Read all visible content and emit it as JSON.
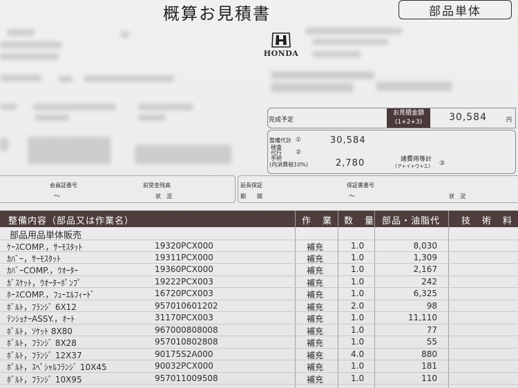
{
  "header": {
    "title": "概算お見積書",
    "badge": "部品単体",
    "brand": "HONDA"
  },
  "summary": {
    "completion_label": "完成予定",
    "estimate_label_1": "お見積金額",
    "estimate_label_2": "(1+2+3)",
    "estimate_total": "30,584",
    "yen": "円",
    "service_label": "整備代計",
    "service_mark": "①",
    "service_value": "30,584",
    "sub_labels": [
      "検査",
      "代行",
      "手続"
    ],
    "sub_mark": "②",
    "tax_label": "(内消費税10%)",
    "tax_value": "2,780",
    "fees_label": "諸費用等計",
    "fees_formula": "(ア+イ+ウ+エ)",
    "fees_mark": "③"
  },
  "info": {
    "member_no": "会員証番号",
    "prepaid": "前受金残高",
    "status": "状　況",
    "tilde": "〜",
    "ext_warranty": "延長保証",
    "period": "期　　間",
    "cert_no": "保証書番号",
    "status2": "状　況"
  },
  "table": {
    "headers": [
      "整備内容（部品又は作業名）",
      "作　業",
      "数　量",
      "部品・油脂代",
      "技　術　料"
    ],
    "category": "部品用品単体販売",
    "rows": [
      {
        "name": "ｹｰｽCOMP.，ｻｰﾓｽﾀｯﾄ",
        "part": "19320PCX000",
        "work": "補充",
        "qty": "1.0",
        "price": "8,030"
      },
      {
        "name": "ｶﾊﾞｰ，ｻｰﾓｽﾀｯﾄ",
        "part": "19311PCX000",
        "work": "補充",
        "qty": "1.0",
        "price": "1,309"
      },
      {
        "name": "ｶﾊﾞｰCOMP.，ｳｵｰﾀｰ",
        "part": "19360PCX000",
        "work": "補充",
        "qty": "1.0",
        "price": "2,167"
      },
      {
        "name": "ｶﾞｽｹｯﾄ，ｳｵｰﾀｰﾎﾟﾝﾌﾟ",
        "part": "19222PCX003",
        "work": "補充",
        "qty": "1.0",
        "price": "242"
      },
      {
        "name": "ﾎｰｽCOMP.，ﾌｭｰｴﾙﾌｨｰﾄﾞ",
        "part": "16720PCX003",
        "work": "補充",
        "qty": "1.0",
        "price": "6,325"
      },
      {
        "name": "ﾎﾞﾙﾄ，ﾌﾗﾝｼﾞ 6X12",
        "part": "957010601202",
        "work": "補充",
        "qty": "2.0",
        "price": "98"
      },
      {
        "name": "ﾃﾝｼｮﾅｰASSY.，ｵｰﾄ",
        "part": "31170PCX003",
        "work": "補充",
        "qty": "1.0",
        "price": "11,110"
      },
      {
        "name": "ﾎﾞﾙﾄ，ｿｹｯﾄ 8X80",
        "part": "967000808008",
        "work": "補充",
        "qty": "1.0",
        "price": "77"
      },
      {
        "name": "ﾎﾞﾙﾄ，ﾌﾗﾝｼﾞ 8X28",
        "part": "957010802808",
        "work": "補充",
        "qty": "1.0",
        "price": "55"
      },
      {
        "name": "ﾎﾞﾙﾄ，ﾌﾗﾝｼﾞ 12X37",
        "part": "90175S2A000",
        "work": "補充",
        "qty": "4.0",
        "price": "880"
      },
      {
        "name": "ﾎﾞﾙﾄ，ｽﾍﾟｼｬﾙﾌﾗﾝｼﾞ 10X45",
        "part": "90032PCX000",
        "work": "補充",
        "qty": "1.0",
        "price": "181"
      },
      {
        "name": "ﾎﾞﾙﾄ，ﾌﾗﾝｼﾞ 10X95",
        "part": "957011009508",
        "work": "補充",
        "qty": "1.0",
        "price": "110"
      }
    ]
  }
}
